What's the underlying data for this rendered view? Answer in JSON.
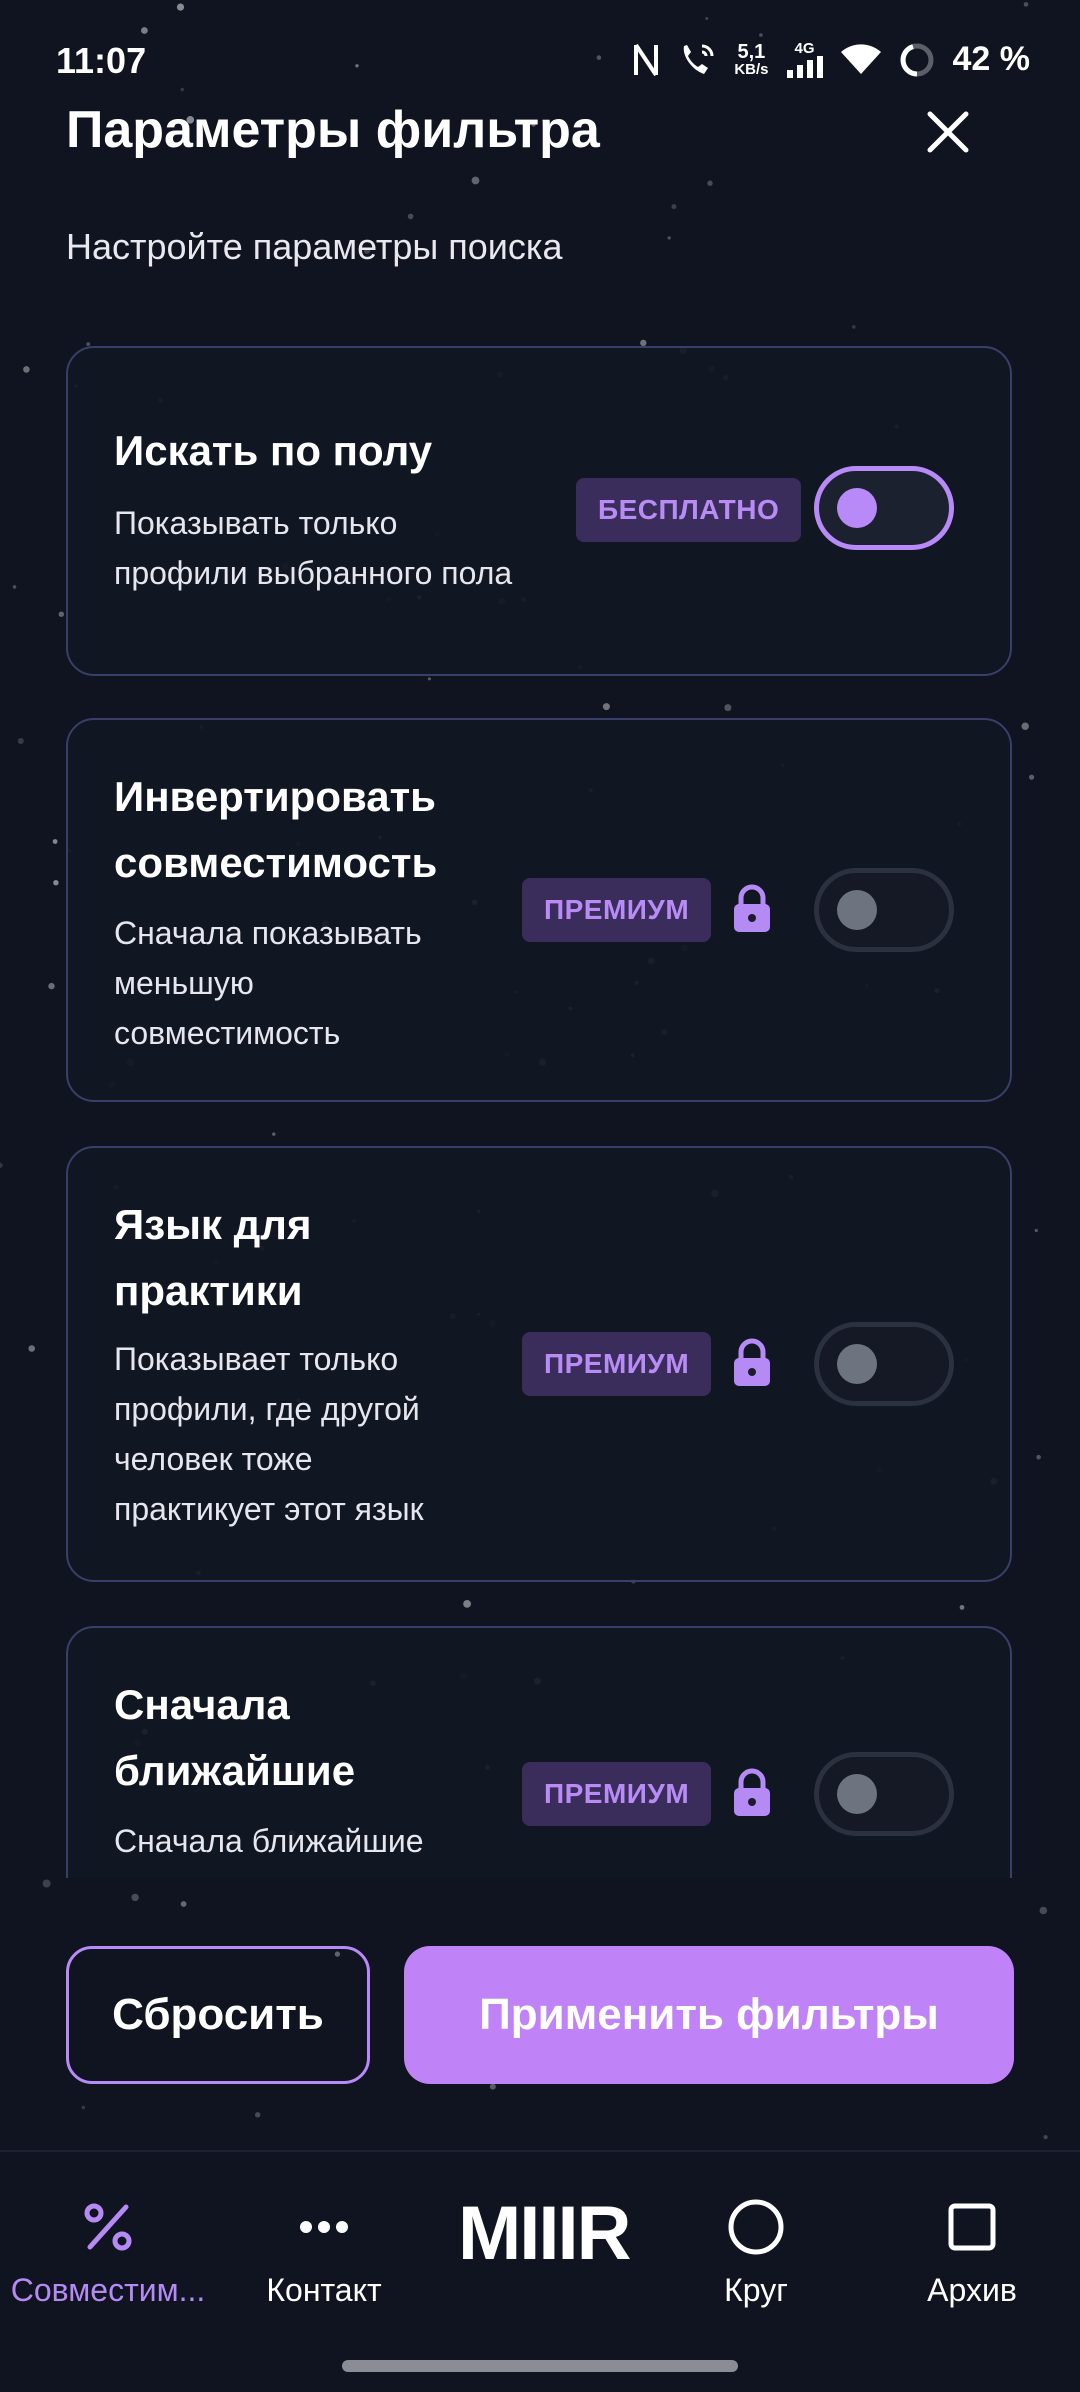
{
  "status_bar": {
    "time": "11:07",
    "net_speed_value": "5,1",
    "net_speed_unit": "KB/s",
    "network_type": "4G",
    "battery": "42 %"
  },
  "header": {
    "title": "Параметры фильтра",
    "subtitle": "Настройте параметры поиска"
  },
  "filters": [
    {
      "title_lines": [
        "Искать по полу"
      ],
      "desc_lines": [
        "Показывать только",
        "профили выбранного пола"
      ],
      "badge": "БЕСПЛАТНО",
      "locked": false,
      "enabled": true
    },
    {
      "title_lines": [
        "Инвертировать",
        "совместимость"
      ],
      "desc_lines": [
        "Сначала показывать",
        "меньшую",
        "совместимость"
      ],
      "badge": "ПРЕМИУМ",
      "locked": true,
      "enabled": false
    },
    {
      "title_lines": [
        "Язык для",
        "практики"
      ],
      "desc_lines": [
        "Показывает только",
        "профили, где другой",
        "человек тоже",
        "практикует этот язык"
      ],
      "badge": "ПРЕМИУМ",
      "locked": true,
      "enabled": false
    },
    {
      "title_lines": [
        "Сначала",
        "ближайшие"
      ],
      "desc_lines": [
        "Сначала ближайшие"
      ],
      "badge": "ПРЕМИУМ",
      "locked": true,
      "enabled": false
    }
  ],
  "actions": {
    "reset_label": "Сбросить",
    "apply_label": "Применить фильтры"
  },
  "nav": {
    "items": [
      {
        "label": "Совместим...",
        "icon": "percent-icon",
        "active": true
      },
      {
        "label": "Контакт",
        "icon": "more-dots-icon",
        "active": false
      },
      {
        "label": "Круг",
        "icon": "circle-icon",
        "active": false
      },
      {
        "label": "Архив",
        "icon": "square-icon",
        "active": false
      }
    ],
    "logo": "MIIIR"
  },
  "colors": {
    "background": "#0f1420",
    "accent": "#c083f7",
    "badge_bg": "#3a2d5c",
    "badge_text": "#b98cf5",
    "card_border": "#3a3e68"
  }
}
